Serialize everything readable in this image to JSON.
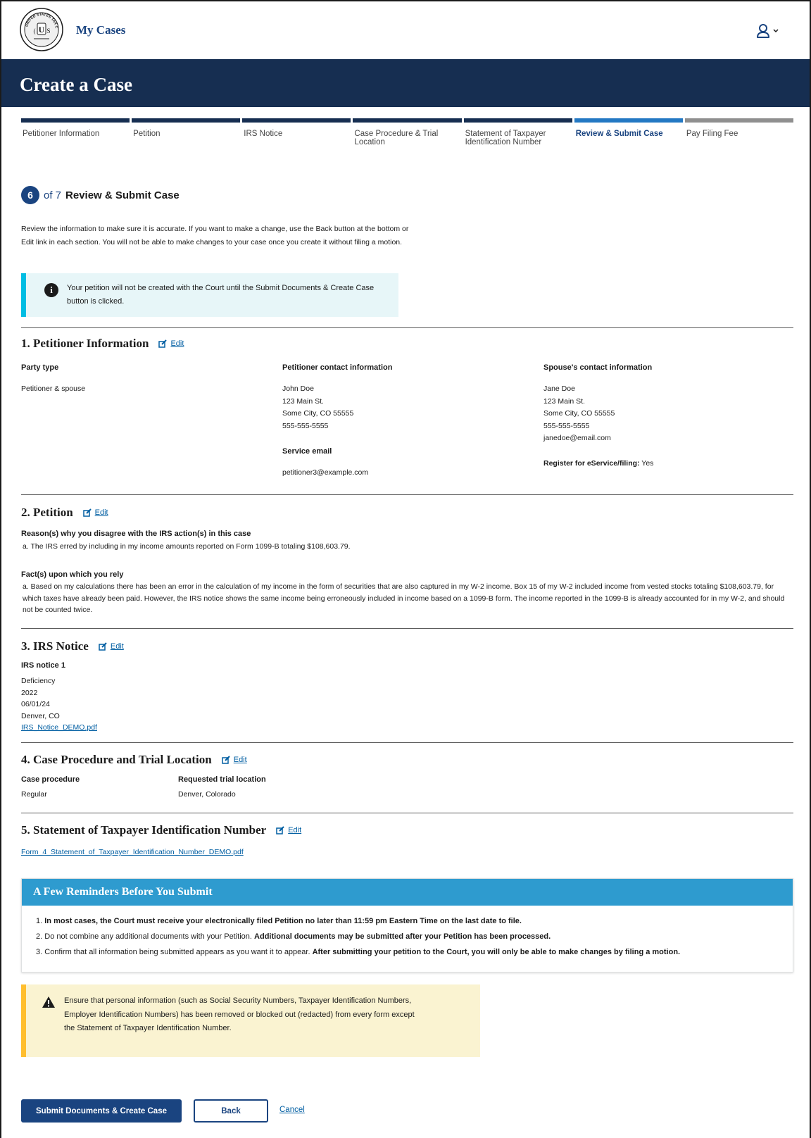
{
  "header": {
    "seal_icon": "us-tax-court-seal-icon",
    "seal_text": "UNITED STATES TAX COURT",
    "app_title": "My Cases",
    "user_icon": "user-icon"
  },
  "banner": {
    "title": "Create a Case"
  },
  "stepper": {
    "steps": [
      {
        "label": "Petitioner Information",
        "state": "complete"
      },
      {
        "label": "Petition",
        "state": "complete"
      },
      {
        "label": "IRS Notice",
        "state": "complete"
      },
      {
        "label": "Case Procedure & Trial Location",
        "state": "complete"
      },
      {
        "label": "Statement of Taxpayer Identification Number",
        "state": "complete"
      },
      {
        "label": "Review & Submit Case",
        "state": "current"
      },
      {
        "label": "Pay Filing Fee",
        "state": "todo"
      }
    ],
    "current_number": "6",
    "of_total": "of 7",
    "current_title": "Review & Submit Case"
  },
  "intro": "Review the information to make sure it is accurate. If you want to make a change, use the Back button at the bottom or Edit link in each section. You will not be able to make changes to your case once you create it without filing a motion.",
  "info_alert": "Your petition will not be created with the Court until the Submit Documents & Create Case button is clicked.",
  "edit_label": "Edit",
  "sections": {
    "petitioner": {
      "title": "1. Petitioner Information",
      "party_type_label": "Party type",
      "party_type_value": "Petitioner & spouse",
      "contact_label": "Petitioner contact information",
      "contact_lines": [
        "John Doe",
        "123 Main St.",
        "Some City, CO 55555",
        "555-555-5555"
      ],
      "service_email_label": "Service email",
      "service_email": "petitioner3@example.com",
      "spouse_label": "Spouse's contact information",
      "spouse_lines": [
        "Jane Doe",
        "123 Main St.",
        "Some City, CO 55555",
        "555-555-5555",
        "janedoe@email.com"
      ],
      "eservice_label": "Register for eService/filing:",
      "eservice_value": "Yes"
    },
    "petition": {
      "title": "2. Petition",
      "reasons_label": "Reason(s) why you disagree with the IRS action(s) in this case",
      "reason_a": "a. The IRS erred by including in my income amounts reported on Form 1099-B totaling $108,603.79.",
      "facts_label": "Fact(s) upon which you rely",
      "fact_a": "a. Based on my calculations there has been an error in the calculation of my income in the form of securities that are also captured in my W-2 income. Box 15 of my W-2 included income from vested stocks totaling $108,603.79, for which taxes have already been paid. However, the IRS notice shows the same income being erroneously included in income based on a 1099-B form. The income reported in the 1099-B is already accounted for in my W-2, and should not be counted twice."
    },
    "irs_notice": {
      "title": "3. IRS Notice",
      "notice_label": "IRS notice 1",
      "lines": [
        "Deficiency",
        "2022",
        "06/01/24",
        "Denver, CO"
      ],
      "file_link": "IRS_Notice_DEMO.pdf"
    },
    "procedure": {
      "title": "4. Case Procedure and Trial Location",
      "procedure_label": "Case procedure",
      "procedure_value": "Regular",
      "location_label": "Requested trial location",
      "location_value": "Denver, Colorado"
    },
    "stin": {
      "title": "5. Statement of Taxpayer Identification Number",
      "file_link": "Form_4_Statement_of_Taxpayer_Identification_Number_DEMO.pdf"
    }
  },
  "reminders": {
    "title": "A Few Reminders Before You Submit",
    "item1_bold": "In most cases, the Court must receive your electronically filed Petition no later than 11:59 pm Eastern Time on the last date to file.",
    "item2_plain": "Do not combine any additional documents with your Petition.",
    "item2_bold": "Additional documents may be submitted after your Petition has been processed.",
    "item3_plain": "Confirm that all information being submitted appears as you want it to appear.",
    "item3_bold": "After submitting your petition to the Court, you will only be able to make changes by filing a motion.",
    "n1": "1.",
    "n2": "2.",
    "n3": "3."
  },
  "warning_alert": "Ensure that personal information (such as Social Security Numbers, Taxpayer Identification Numbers, Employer Identification Numbers) has been removed or blocked out (redacted) from every form except the Statement of Taxpayer Identification Number.",
  "actions": {
    "submit": "Submit Documents & Create Case",
    "back": "Back",
    "cancel": "Cancel"
  },
  "colors": {
    "brand_navy": "#162e51",
    "link_blue": "#005ea2",
    "current_step": "#2378c3",
    "info_accent": "#00bde3",
    "warn_accent": "#ffbe2e",
    "reminder_header": "#2e9bcf"
  }
}
